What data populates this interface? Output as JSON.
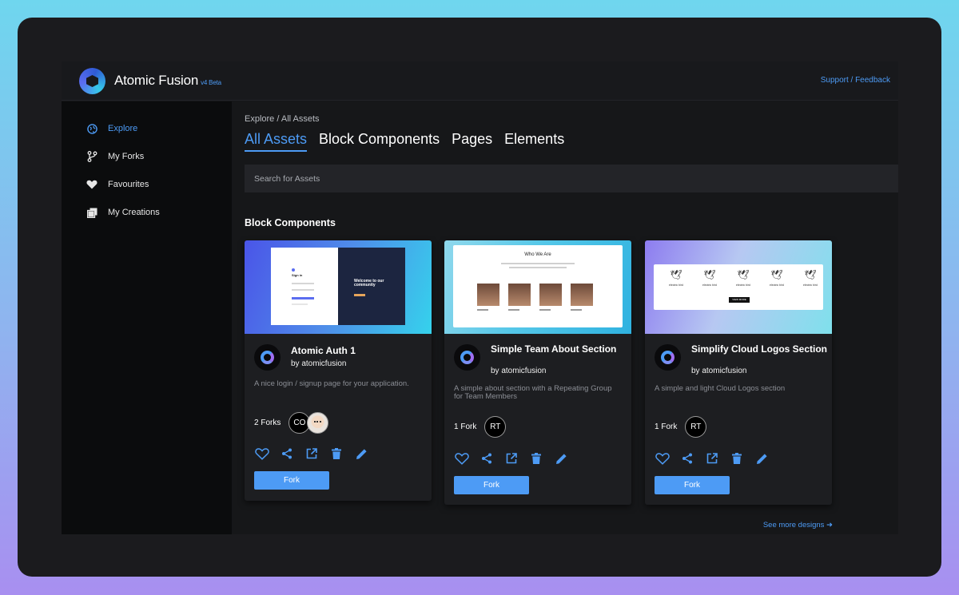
{
  "app": {
    "name": "Atomic Fusion",
    "version": "v4 Beta",
    "support_link": "Support / Feedback"
  },
  "sidebar": {
    "items": [
      {
        "label": "Explore",
        "icon": "globe-icon",
        "active": true
      },
      {
        "label": "My Forks",
        "icon": "fork-icon",
        "active": false
      },
      {
        "label": "Favourites",
        "icon": "heart-icon",
        "active": false
      },
      {
        "label": "My Creations",
        "icon": "copy-icon",
        "active": false
      }
    ]
  },
  "main": {
    "breadcrumb": "Explore / All Assets",
    "tabs": [
      {
        "label": "All Assets",
        "active": true
      },
      {
        "label": "Block Components",
        "active": false
      },
      {
        "label": "Pages",
        "active": false
      },
      {
        "label": "Elements",
        "active": false
      }
    ],
    "search_placeholder": "Search for Assets",
    "section_title": "Block Components",
    "see_more": "See more designs ➜"
  },
  "cards": [
    {
      "title": "Atomic Auth 1",
      "author": "by atomicfusion",
      "description": "A nice login / signup page for your application.",
      "forks": "2 Forks",
      "users": [
        "CO",
        ""
      ],
      "fork_button": "Fork",
      "thumb_texts": [
        "Sign in",
        "Welcome to our community"
      ]
    },
    {
      "title": "Simple Team About Section",
      "author": "by atomicfusion",
      "description": "A simple about section with a Repeating Group for Team Members",
      "forks": "1 Fork",
      "users": [
        "RT"
      ],
      "fork_button": "Fork",
      "thumb_texts": [
        "Who We Are"
      ]
    },
    {
      "title": "Simplify Cloud Logos Section",
      "author": "by atomicfusion",
      "description": "A simple and light Cloud Logos section",
      "forks": "1 Fork",
      "users": [
        "RT"
      ],
      "fork_button": "Fork",
      "thumb_texts": [
        "electric bird",
        "VIEW MORE"
      ]
    }
  ],
  "colors": {
    "accent": "#4d9bf5",
    "background": "#161719",
    "sidebar": "#0b0c0d",
    "card": "#1d1e21"
  },
  "card_actions": [
    "heart-icon",
    "share-icon",
    "external-link-icon",
    "trash-icon",
    "edit-icon"
  ]
}
